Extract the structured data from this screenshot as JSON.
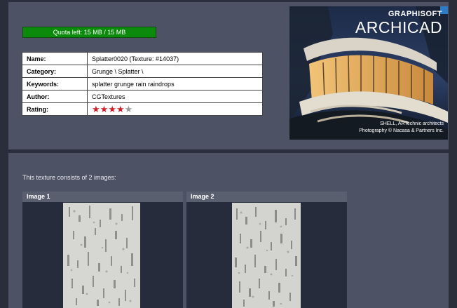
{
  "quota": {
    "text": "Quota left: 15 MB / 15 MB"
  },
  "info": [
    {
      "key": "Name:",
      "value": "Splatter0020 (Texture: #14037)"
    },
    {
      "key": "Category:",
      "value": "Grunge \\ Splatter \\"
    },
    {
      "key": "Keywords:",
      "value": "splatter grunge rain raindrops"
    },
    {
      "key": "Author:",
      "value": "CGTextures"
    },
    {
      "key": "Rating:",
      "value": ""
    }
  ],
  "rating": {
    "value": 4,
    "max": 5
  },
  "ad": {
    "brand_sub": "GRAPHISOFT",
    "brand_main": "ARCHICAD",
    "credit_line1": "SHELL, ARTechnic architects",
    "credit_line2": "Photography © Nacasa & Partners Inc."
  },
  "textures": {
    "intro": "This texture consists of 2 images:",
    "images": [
      {
        "label": "Image 1"
      },
      {
        "label": "Image 2"
      }
    ]
  },
  "colors": {
    "quota_bar": "#0b8a0b",
    "star_filled": "#cc1f26",
    "star_empty": "#9b9b9b",
    "panel": "#4d5264"
  },
  "icons": {
    "rating": "star-icon"
  }
}
